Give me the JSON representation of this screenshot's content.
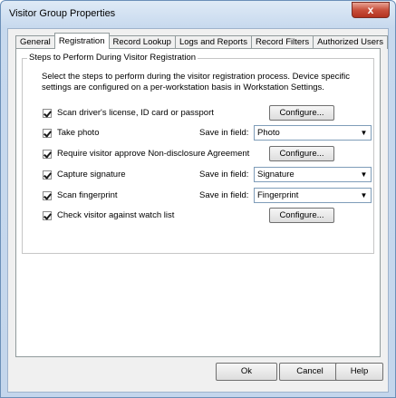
{
  "window": {
    "title": "Visitor Group Properties",
    "close_glyph": "x"
  },
  "tabs": [
    {
      "label": "General",
      "active": false
    },
    {
      "label": "Registration",
      "active": true
    },
    {
      "label": "Record Lookup",
      "active": false
    },
    {
      "label": "Logs and Reports",
      "active": false
    },
    {
      "label": "Record Filters",
      "active": false
    },
    {
      "label": "Authorized Users",
      "active": false
    }
  ],
  "group": {
    "title": "Steps to Perform During Visitor Registration",
    "description": "Select the steps to perform during the visitor registration process. Device specific settings are configured on a per-workstation basis in Workstation Settings."
  },
  "steps": [
    {
      "label": "Scan driver's license, ID card or passport",
      "checked": true,
      "button": "Configure..."
    },
    {
      "label": "Take photo",
      "checked": true,
      "field_label": "Save in field:",
      "field_value": "Photo"
    },
    {
      "label": "Require visitor approve Non-disclosure Agreement",
      "checked": true,
      "button": "Configure..."
    },
    {
      "label": "Capture signature",
      "checked": true,
      "field_label": "Save in field:",
      "field_value": "Signature"
    },
    {
      "label": "Scan fingerprint",
      "checked": true,
      "field_label": "Save in field:",
      "field_value": "Fingerprint"
    },
    {
      "label": "Check visitor against watch list",
      "checked": true,
      "button": "Configure..."
    }
  ],
  "footer": {
    "ok": "Ok",
    "cancel": "Cancel",
    "help": "Help"
  }
}
